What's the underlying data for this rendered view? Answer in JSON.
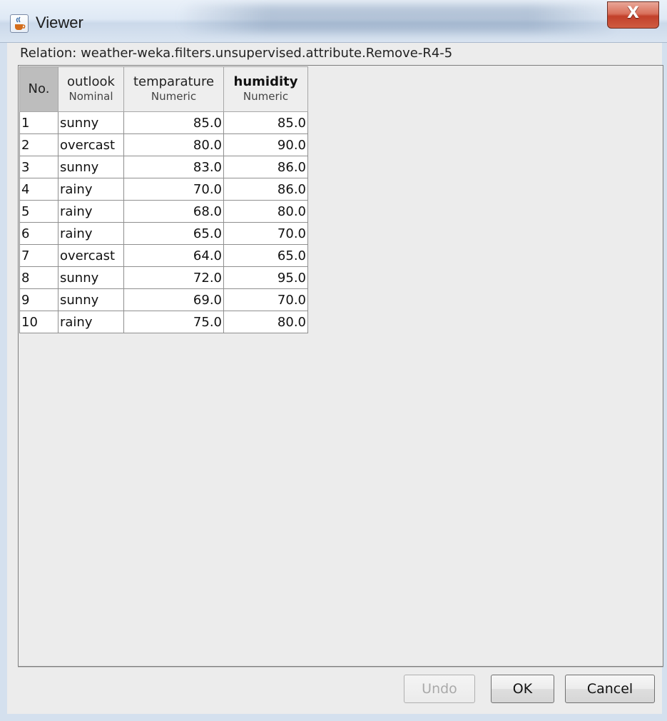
{
  "window": {
    "title": "Viewer",
    "close_glyph": "X"
  },
  "relation": {
    "label": "Relation: weather-weka.filters.unsupervised.attribute.Remove-R4-5"
  },
  "table": {
    "columns": [
      {
        "name": "No.",
        "type": ""
      },
      {
        "name": "outlook",
        "type": "Nominal"
      },
      {
        "name": "temparature",
        "type": "Numeric"
      },
      {
        "name": "humidity",
        "type": "Numeric"
      }
    ],
    "rows": [
      [
        "1",
        "sunny",
        "85.0",
        "85.0"
      ],
      [
        "2",
        "overcast",
        "80.0",
        "90.0"
      ],
      [
        "3",
        "sunny",
        "83.0",
        "86.0"
      ],
      [
        "4",
        "rainy",
        "70.0",
        "86.0"
      ],
      [
        "5",
        "rainy",
        "68.0",
        "80.0"
      ],
      [
        "6",
        "rainy",
        "65.0",
        "70.0"
      ],
      [
        "7",
        "overcast",
        "64.0",
        "65.0"
      ],
      [
        "8",
        "sunny",
        "72.0",
        "95.0"
      ],
      [
        "9",
        "sunny",
        "69.0",
        "70.0"
      ],
      [
        "10",
        "rainy",
        "75.0",
        "80.0"
      ]
    ]
  },
  "buttons": {
    "undo": "Undo",
    "ok": "OK",
    "cancel": "Cancel"
  },
  "icons": {
    "app": "java-cup-icon",
    "close": "close-icon"
  }
}
